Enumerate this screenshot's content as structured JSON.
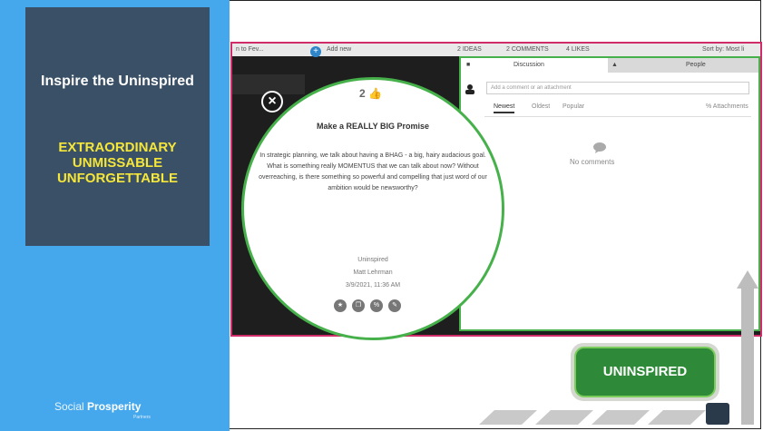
{
  "slide": {
    "title": "Inspire the Uninspired",
    "tagline_line1": "EXTRAORDINARY",
    "tagline_line2": "UNMISSABLE",
    "tagline_line3": "UNFORGETTABLE",
    "logo_light": "Social ",
    "logo_bold": "Prosperity",
    "logo_sub": "Partners",
    "badge": "UNINSPIRED"
  },
  "app": {
    "left_fragment": "n to Fev...",
    "add_new": "Add new",
    "ideas_count": "2 IDEAS",
    "comments_count": "2 COMMENTS",
    "likes_count": "4 LIKES",
    "sort_label": "Sort by: Most li",
    "tabs": {
      "discussion": "Discussion",
      "people": "People"
    },
    "comment_placeholder": "Add a comment or an attachment",
    "filters": {
      "newest": "Newest",
      "oldest": "Oldest",
      "popular": "Popular",
      "attachments": "% Attachments"
    },
    "no_comments": "No comments",
    "idea": {
      "likes": "2",
      "title": "Make a REALLY BIG Promise",
      "text": "In strategic planning, we talk about having a BHAG - a big, hairy audacious goal. What is something really MOMENTUS that we can talk about now? Without overreaching, is there something so powerful and compelling that just word of our ambition would be newsworthy?",
      "category": "Uninspired",
      "author": "Matt Lehrman",
      "date": "3/9/2021, 11:36 AM"
    }
  },
  "colors": {
    "blue_panel": "#45a8ec",
    "title_card": "#3a5066",
    "yellow": "#f5e63a",
    "green": "#46b14a",
    "magenta": "#d02c6a",
    "badge_green": "#2e8a38"
  },
  "icons": [
    "close-icon",
    "thumbs-up-icon",
    "chat-icon",
    "user-icon",
    "attachment-icon",
    "star-icon",
    "copy-icon",
    "link-icon",
    "edit-icon",
    "plus-icon"
  ]
}
